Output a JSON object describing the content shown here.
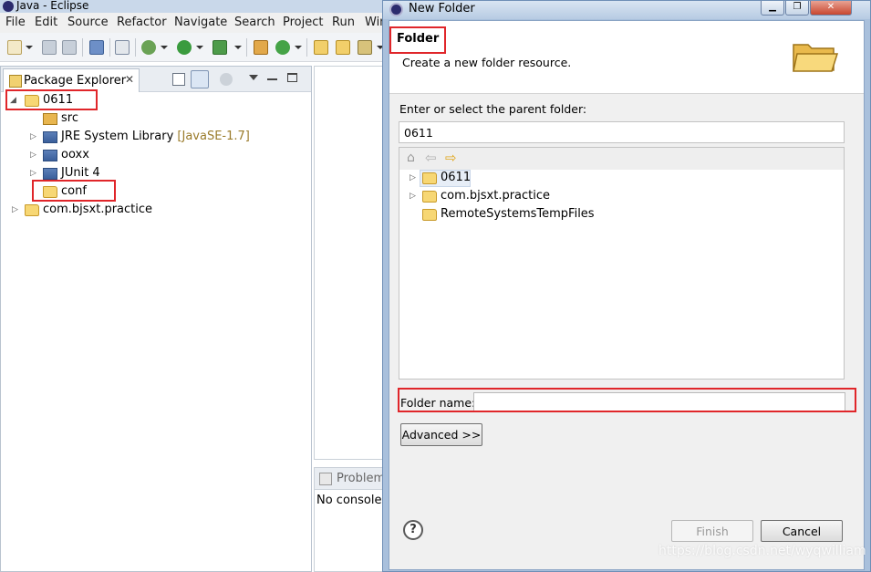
{
  "eclipse": {
    "title": "Java - Eclipse",
    "menu": [
      "File",
      "Edit",
      "Source",
      "Refactor",
      "Navigate",
      "Search",
      "Project",
      "Run",
      "Win"
    ],
    "explorer": {
      "tab_label": "Package Explorer",
      "items": [
        {
          "label": "0611",
          "decoration": "",
          "icon": "project-folder-icon"
        },
        {
          "label": "src",
          "decoration": "",
          "icon": "source-folder-icon"
        },
        {
          "label": "JRE System Library",
          "decoration": "[JavaSE-1.7]",
          "icon": "library-icon"
        },
        {
          "label": "ooxx",
          "decoration": "",
          "icon": "library-icon"
        },
        {
          "label": "JUnit 4",
          "decoration": "",
          "icon": "library-icon"
        },
        {
          "label": "conf",
          "decoration": "",
          "icon": "folder-icon"
        },
        {
          "label": "com.bjsxt.practice",
          "decoration": "",
          "icon": "project-folder-icon"
        }
      ]
    },
    "console": {
      "tab_label": "Problem",
      "message": "No consoles"
    }
  },
  "dialog": {
    "title": "New Folder",
    "banner_title": "Folder",
    "banner_desc": "Create a new folder resource.",
    "parent_label": "Enter or select the parent folder:",
    "parent_value": "0611",
    "tree_items": [
      {
        "label": "0611",
        "icon": "project-folder-icon"
      },
      {
        "label": "com.bjsxt.practice",
        "icon": "project-folder-icon"
      },
      {
        "label": "RemoteSystemsTempFiles",
        "icon": "project-folder-icon"
      }
    ],
    "folder_name_label": "Folder name:",
    "folder_name_value": "",
    "advanced_label": "Advanced >>",
    "finish_label": "Finish",
    "cancel_label": "Cancel",
    "help_symbol": "?"
  },
  "watermark": "https://blog.csdn.net/wyqwilliam",
  "colors": {
    "highlight": "#e0262a",
    "dialog_frame": "#a9c0dc"
  }
}
